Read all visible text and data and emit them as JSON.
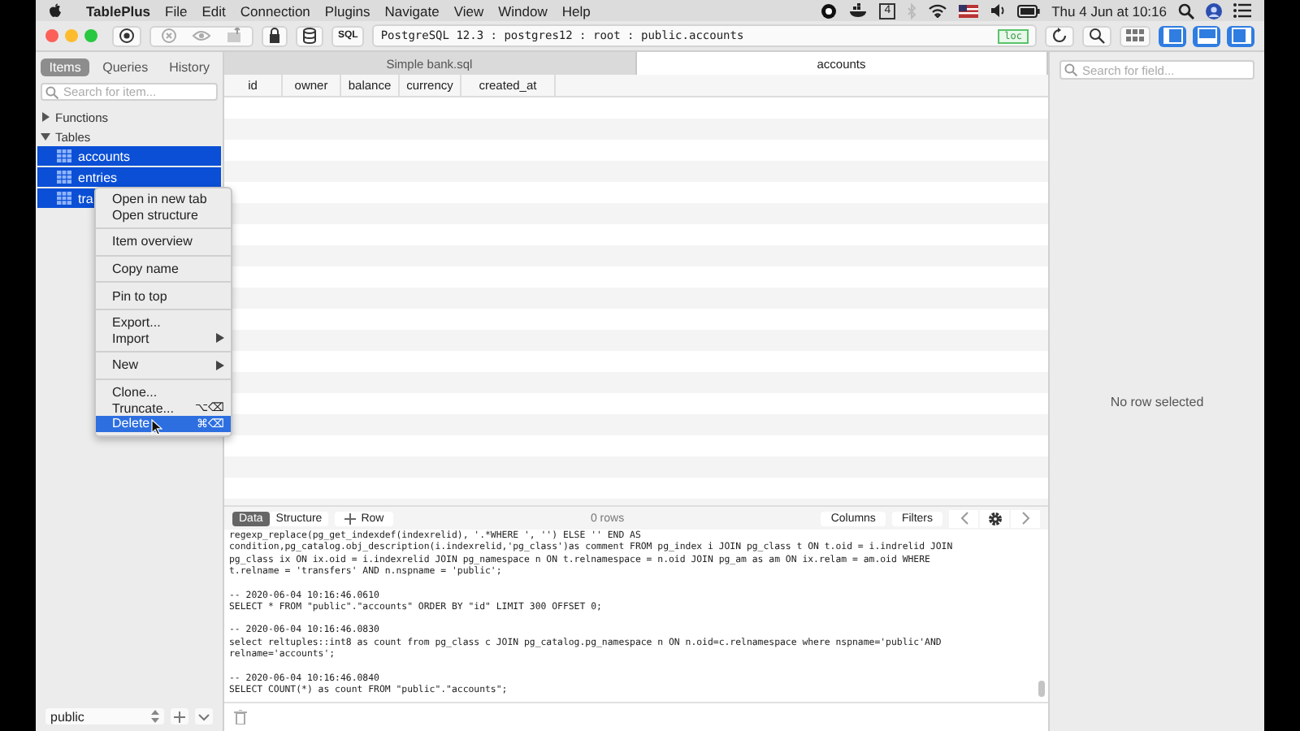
{
  "menubar": {
    "app": "TablePlus",
    "menus": [
      "File",
      "Edit",
      "Connection",
      "Plugins",
      "Navigate",
      "View",
      "Window",
      "Help"
    ],
    "status_badge": "4",
    "clock": "Thu 4 Jun at 10:16"
  },
  "toolbar": {
    "sql_button": "SQL",
    "connection": "PostgreSQL 12.3 : postgres12 : root : public.accounts",
    "env_badge": "loc"
  },
  "sidebar": {
    "tabs": [
      {
        "label": "Items",
        "selected": true
      },
      {
        "label": "Queries",
        "selected": false
      },
      {
        "label": "History",
        "selected": false
      }
    ],
    "search": {
      "placeholder": "Search for item..."
    },
    "tree": [
      {
        "label": "Functions",
        "expanded": false
      },
      {
        "label": "Tables",
        "expanded": true,
        "children": [
          {
            "label": "accounts",
            "selected": true
          },
          {
            "label": "entries",
            "selected": true
          },
          {
            "label": "tra",
            "selected": true
          }
        ]
      }
    ],
    "schema": "public"
  },
  "editor_tabs": [
    {
      "label": "Simple bank.sql",
      "selected": false
    },
    {
      "label": "accounts",
      "selected": true
    }
  ],
  "table": {
    "columns": [
      "id",
      "owner",
      "balance",
      "currency",
      "created_at"
    ]
  },
  "context_menu": [
    [
      {
        "label": "Open in new tab",
        "selected": false
      },
      {
        "label": "Open structure",
        "selected": false
      }
    ],
    [
      {
        "label": "Item overview",
        "selected": false
      }
    ],
    [
      {
        "label": "Copy name",
        "selected": false
      }
    ],
    [
      {
        "label": "Pin to top",
        "selected": false
      }
    ],
    [
      {
        "label": "Export...",
        "selected": false
      },
      {
        "label": "Import",
        "submenu": true,
        "selected": false
      }
    ],
    [
      {
        "label": "New",
        "submenu": true,
        "selected": false
      }
    ],
    [
      {
        "label": "Clone...",
        "selected": false
      },
      {
        "label": "Truncate...",
        "shortcut": "⌥⌫",
        "selected": false
      },
      {
        "label": "Delete",
        "shortcut": "⌘⌫",
        "selected": true
      }
    ]
  ],
  "bottom_bar": {
    "views": [
      {
        "label": "Data",
        "selected": true
      },
      {
        "label": "Structure",
        "selected": false
      }
    ],
    "add_row": "Row",
    "row_count": "0 rows",
    "buttons": [
      "Columns",
      "Filters"
    ]
  },
  "log": [
    "regexp_replace(pg_get_indexdef(indexrelid), '.*WHERE ', '') ELSE '' END AS\ncondition,pg_catalog.obj_description(i.indexrelid,'pg_class')as comment FROM pg_index i JOIN pg_class t ON t.oid = i.indrelid JOIN\npg_class ix ON ix.oid = i.indexrelid JOIN pg_namespace n ON t.relnamespace = n.oid JOIN pg_am as am ON ix.relam = am.oid WHERE\nt.relname = 'transfers' AND n.nspname = 'public';",
    "-- 2020-06-04 10:16:46.0610\nSELECT * FROM \"public\".\"accounts\" ORDER BY \"id\" LIMIT 300 OFFSET 0;",
    "-- 2020-06-04 10:16:46.0830\nselect reltuples::int8 as count from pg_class c JOIN pg_catalog.pg_namespace n ON n.oid=c.relnamespace where nspname='public'AND\nrelname='accounts';",
    "-- 2020-06-04 10:16:46.0840\nSELECT COUNT(*) as count FROM \"public\".\"accounts\";"
  ],
  "detail": {
    "search": {
      "placeholder": "Search for field..."
    },
    "empty_message": "No row selected"
  }
}
